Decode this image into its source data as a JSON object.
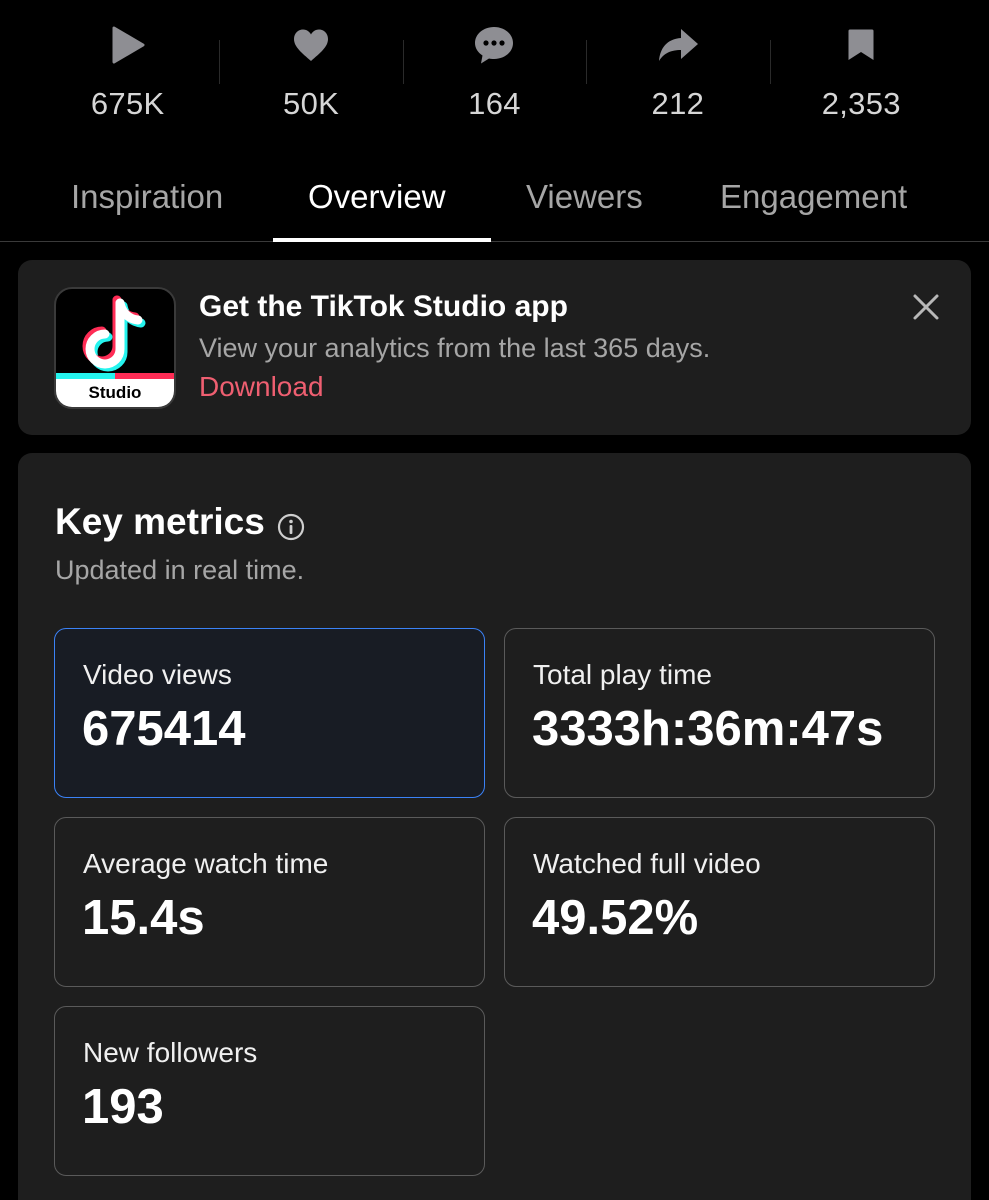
{
  "stats": [
    {
      "icon": "play-icon",
      "value": "675K"
    },
    {
      "icon": "heart-icon",
      "value": "50K"
    },
    {
      "icon": "comment-icon",
      "value": "164"
    },
    {
      "icon": "share-icon",
      "value": "212"
    },
    {
      "icon": "bookmark-icon",
      "value": "2,353"
    }
  ],
  "tabs": [
    {
      "label": "Inspiration",
      "active": false
    },
    {
      "label": "Overview",
      "active": true
    },
    {
      "label": "Viewers",
      "active": false
    },
    {
      "label": "Engagement",
      "active": false
    }
  ],
  "banner": {
    "app_icon_label": "Studio",
    "title": "Get the TikTok Studio app",
    "subtitle": "View your analytics from the last 365 days.",
    "link": "Download",
    "close_icon": "close-icon"
  },
  "key_metrics": {
    "title": "Key metrics",
    "info_icon": "info-icon",
    "subtitle": "Updated in real time.",
    "items": [
      {
        "label": "Video views",
        "value": "675414",
        "selected": true
      },
      {
        "label": "Total play time",
        "value": "3333h:36m:47s",
        "selected": false
      },
      {
        "label": "Average watch time",
        "value": "15.4s",
        "selected": false
      },
      {
        "label": "Watched full video",
        "value": "49.52%",
        "selected": false
      },
      {
        "label": "New followers",
        "value": "193",
        "selected": false
      }
    ]
  },
  "colors": {
    "background": "#000000",
    "card": "#1e1e1e",
    "accent_link": "#ef5f71",
    "selected_border": "#3b82f6",
    "muted_text": "#a6a6a6"
  }
}
